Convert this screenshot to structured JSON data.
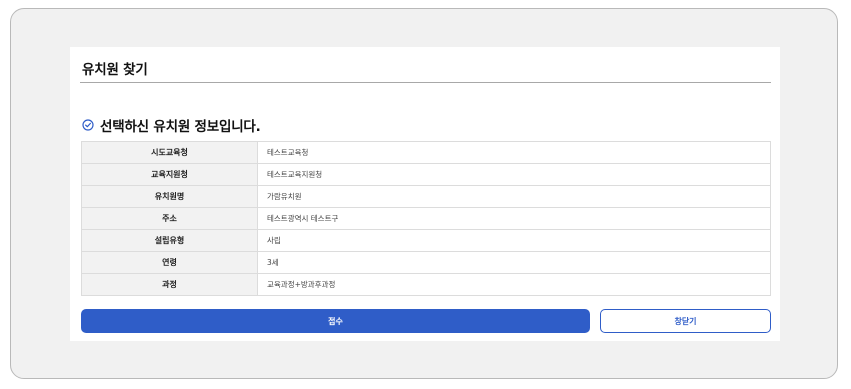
{
  "page": {
    "title": "유치원 찾기"
  },
  "section": {
    "heading": "선택하신 유치원 정보입니다.",
    "icon": "check-circle-icon"
  },
  "info_rows": [
    {
      "label": "시도교육청",
      "value": "테스트교육청"
    },
    {
      "label": "교육지원청",
      "value": "테스트교육지원청"
    },
    {
      "label": "유치원명",
      "value": "가람유치원"
    },
    {
      "label": "주소",
      "value": "테스트광역시 테스트구"
    },
    {
      "label": "설립유형",
      "value": "사립"
    },
    {
      "label": "연령",
      "value": "3세"
    },
    {
      "label": "과정",
      "value": "교육과정+방과후과정"
    }
  ],
  "buttons": {
    "submit_label": "접수",
    "close_label": "창닫기"
  },
  "colors": {
    "accent": "#2f5dc8",
    "frame_background": "#f1f1f1",
    "label_background": "#f2f2f2"
  }
}
